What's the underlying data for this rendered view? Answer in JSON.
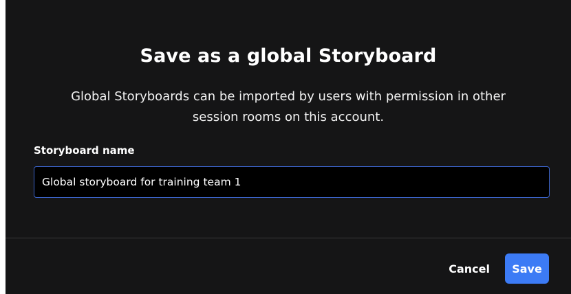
{
  "dialog": {
    "title": "Save as a global Storyboard",
    "description": "Global Storyboards can be imported by users with permission in other session rooms on this account.",
    "field_label": "Storyboard name",
    "field_value": "Global storyboard for training team 1",
    "cancel_label": "Cancel",
    "save_label": "Save"
  },
  "colors": {
    "background": "#151516",
    "input_background": "#000000",
    "input_border": "#3b63c9",
    "primary_button": "#3c7bf5",
    "divider": "#3a3a3c"
  }
}
